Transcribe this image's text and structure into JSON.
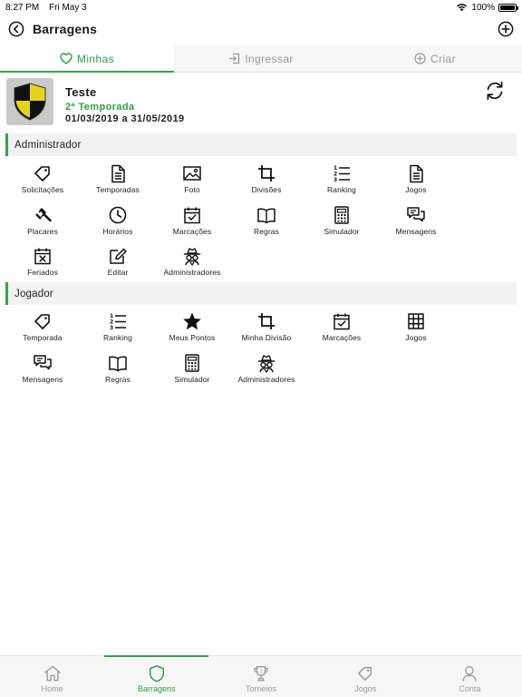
{
  "status": {
    "time": "8:27 PM",
    "date": "Fri May 3",
    "battery": "100%",
    "battery_level": 1.0
  },
  "nav": {
    "title": "Barragens"
  },
  "tabs": [
    {
      "label": "Minhas"
    },
    {
      "label": "Ingressar"
    },
    {
      "label": "Criar"
    }
  ],
  "league": {
    "name": "Teste",
    "season": "2ª Temporada",
    "dates": "01/03/2019 a 31/05/2019"
  },
  "admin": {
    "title": "Administrador",
    "items": [
      {
        "label": "Solicitações",
        "icon": "tag-icon"
      },
      {
        "label": "Temporadas",
        "icon": "document-icon"
      },
      {
        "label": "Foto",
        "icon": "image-icon"
      },
      {
        "label": "Divisões",
        "icon": "crop-icon"
      },
      {
        "label": "Ranking",
        "icon": "numbered-list-icon"
      },
      {
        "label": "Jogos",
        "icon": "document-icon"
      },
      {
        "label": "Placares",
        "icon": "gavel-icon"
      },
      {
        "label": "Horários",
        "icon": "clock-icon"
      },
      {
        "label": "Marcações",
        "icon": "calendar-check-icon"
      },
      {
        "label": "Regras",
        "icon": "book-icon"
      },
      {
        "label": "Simulador",
        "icon": "calculator-icon"
      },
      {
        "label": "Mensagens",
        "icon": "chat-icon"
      },
      {
        "label": "Feriados",
        "icon": "calendar-x-icon"
      },
      {
        "label": "Editar",
        "icon": "edit-icon"
      },
      {
        "label": "Administradores",
        "icon": "spy-icon"
      }
    ]
  },
  "player": {
    "title": "Jogador",
    "items": [
      {
        "label": "Temporada",
        "icon": "tag-icon"
      },
      {
        "label": "Ranking",
        "icon": "numbered-list-icon"
      },
      {
        "label": "Meus Pontos",
        "icon": "star-icon"
      },
      {
        "label": "Minha Divisão",
        "icon": "crop-icon"
      },
      {
        "label": "Marcações",
        "icon": "calendar-check-icon"
      },
      {
        "label": "Jogos",
        "icon": "grid-icon"
      },
      {
        "label": "Mensagens",
        "icon": "chat-icon"
      },
      {
        "label": "Regras",
        "icon": "book-icon"
      },
      {
        "label": "Simulador",
        "icon": "calculator-icon"
      },
      {
        "label": "Administradores",
        "icon": "spy-icon"
      }
    ]
  },
  "tabbar": [
    {
      "label": "Home",
      "icon": "home-icon"
    },
    {
      "label": "Barragens",
      "icon": "shield-icon"
    },
    {
      "label": "Torneios",
      "icon": "trophy-icon"
    },
    {
      "label": "Jogos",
      "icon": "tag-icon"
    },
    {
      "label": "Conta",
      "icon": "user-icon"
    }
  ],
  "colors": {
    "accent": "#2e9e44",
    "inactive": "#9a9a9a",
    "section_bg": "#f2f2f2"
  }
}
